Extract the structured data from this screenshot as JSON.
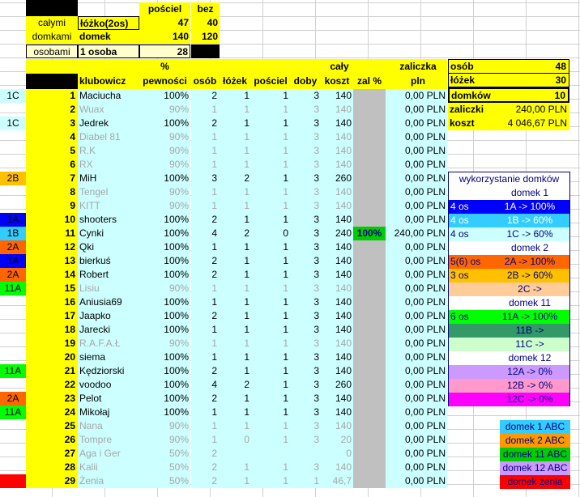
{
  "top_table": {
    "hdr_poscieli": "pościel",
    "hdr_bez": "bez",
    "row1_label": "całymi",
    "row1_name": "łóżko(2os)",
    "row1_v1": "47",
    "row1_v2": "40",
    "row2_label": "domkami",
    "row2_name": "domek",
    "row2_v1": "140",
    "row2_v2": "120",
    "row3_label": "osobami",
    "row3_name": "1 osoba",
    "row3_v1": "28"
  },
  "headers": {
    "pct_top": "%",
    "klubowicz": "klubowicz",
    "pewnosci": "pewności",
    "osob": "osób",
    "lozek": "łóżek",
    "posciel": "pościel",
    "doby": "doby",
    "caly": "cały",
    "koszt": "koszt",
    "zal": "zal %",
    "zaliczka": "zaliczka",
    "pln": "pln"
  },
  "rows": [
    {
      "code": "1C",
      "num": "1",
      "name": "Maciucha",
      "pct": "100%",
      "osob": "2",
      "lozek": "1",
      "posciel": "1",
      "doby": "3",
      "koszt": "140",
      "zal": "",
      "zaliczka": "0,00 PLN",
      "faint": false
    },
    {
      "code": "",
      "num": "2",
      "name": "Wuax",
      "pct": "90%",
      "osob": "1",
      "lozek": "1",
      "posciel": "1",
      "doby": "3",
      "koszt": "140",
      "zal": "",
      "zaliczka": "0,00 PLN",
      "faint": true
    },
    {
      "code": "1C",
      "num": "3",
      "name": "Jedrek",
      "pct": "100%",
      "osob": "2",
      "lozek": "1",
      "posciel": "1",
      "doby": "3",
      "koszt": "140",
      "zal": "",
      "zaliczka": "0,00 PLN",
      "faint": false
    },
    {
      "code": "",
      "num": "4",
      "name": "Diabel 81",
      "pct": "90%",
      "osob": "1",
      "lozek": "1",
      "posciel": "1",
      "doby": "3",
      "koszt": "140",
      "zal": "",
      "zaliczka": "0,00 PLN",
      "faint": true
    },
    {
      "code": "",
      "num": "5",
      "name": "R.K",
      "pct": "90%",
      "osob": "1",
      "lozek": "1",
      "posciel": "1",
      "doby": "3",
      "koszt": "140",
      "zal": "",
      "zaliczka": "0,00 PLN",
      "faint": true
    },
    {
      "code": "",
      "num": "6",
      "name": "RX",
      "pct": "90%",
      "osob": "1",
      "lozek": "1",
      "posciel": "1",
      "doby": "3",
      "koszt": "140",
      "zal": "",
      "zaliczka": "0,00 PLN",
      "faint": true
    },
    {
      "code": "2B",
      "num": "7",
      "name": "MiH",
      "pct": "100%",
      "osob": "3",
      "lozek": "2",
      "posciel": "1",
      "doby": "3",
      "koszt": "260",
      "zal": "",
      "zaliczka": "0,00 PLN",
      "faint": false
    },
    {
      "code": "",
      "num": "8",
      "name": "Tengel",
      "pct": "90%",
      "osob": "1",
      "lozek": "1",
      "posciel": "1",
      "doby": "3",
      "koszt": "140",
      "zal": "",
      "zaliczka": "0,00 PLN",
      "faint": true
    },
    {
      "code": "",
      "num": "9",
      "name": "KITT",
      "pct": "90%",
      "osob": "1",
      "lozek": "1",
      "posciel": "1",
      "doby": "3",
      "koszt": "140",
      "zal": "",
      "zaliczka": "0,00 PLN",
      "faint": true
    },
    {
      "code": "1A",
      "num": "10",
      "name": "shooters",
      "pct": "100%",
      "osob": "2",
      "lozek": "1",
      "posciel": "1",
      "doby": "3",
      "koszt": "140",
      "zal": "",
      "zaliczka": "0,00 PLN",
      "faint": false
    },
    {
      "code": "1B",
      "num": "11",
      "name": "Cynki",
      "pct": "100%",
      "osob": "4",
      "lozek": "2",
      "posciel": "0",
      "doby": "3",
      "koszt": "240",
      "zal": "100%",
      "zaliczka": "240,00 PLN",
      "faint": false
    },
    {
      "code": "2A",
      "num": "12",
      "name": "Qki",
      "pct": "100%",
      "osob": "1",
      "lozek": "1",
      "posciel": "1",
      "doby": "3",
      "koszt": "140",
      "zal": "",
      "zaliczka": "0,00 PLN",
      "faint": false
    },
    {
      "code": "1A",
      "num": "13",
      "name": "bierkuś",
      "pct": "100%",
      "osob": "2",
      "lozek": "1",
      "posciel": "1",
      "doby": "3",
      "koszt": "140",
      "zal": "",
      "zaliczka": "0,00 PLN",
      "faint": false
    },
    {
      "code": "2A",
      "num": "14",
      "name": "Robert",
      "pct": "100%",
      "osob": "2",
      "lozek": "1",
      "posciel": "1",
      "doby": "3",
      "koszt": "140",
      "zal": "",
      "zaliczka": "0,00 PLN",
      "faint": false
    },
    {
      "code": "11A",
      "num": "15",
      "name": "Lisiu",
      "pct": "90%",
      "osob": "1",
      "lozek": "1",
      "posciel": "1",
      "doby": "3",
      "koszt": "140",
      "zal": "",
      "zaliczka": "0,00 PLN",
      "faint": true
    },
    {
      "code": "",
      "num": "16",
      "name": "Aniusia69",
      "pct": "100%",
      "osob": "1",
      "lozek": "1",
      "posciel": "1",
      "doby": "3",
      "koszt": "140",
      "zal": "",
      "zaliczka": "0,00 PLN",
      "faint": false
    },
    {
      "code": "",
      "num": "17",
      "name": "Jaapko",
      "pct": "100%",
      "osob": "2",
      "lozek": "1",
      "posciel": "1",
      "doby": "3",
      "koszt": "140",
      "zal": "",
      "zaliczka": "0,00 PLN",
      "faint": false
    },
    {
      "code": "",
      "num": "18",
      "name": "Jarecki",
      "pct": "100%",
      "osob": "1",
      "lozek": "1",
      "posciel": "1",
      "doby": "3",
      "koszt": "140",
      "zal": "",
      "zaliczka": "0,00 PLN",
      "faint": false
    },
    {
      "code": "",
      "num": "19",
      "name": "R.A.F.A.Ł",
      "pct": "90%",
      "osob": "1",
      "lozek": "1",
      "posciel": "1",
      "doby": "3",
      "koszt": "140",
      "zal": "",
      "zaliczka": "0,00 PLN",
      "faint": true
    },
    {
      "code": "",
      "num": "20",
      "name": "siema",
      "pct": "100%",
      "osob": "1",
      "lozek": "1",
      "posciel": "1",
      "doby": "3",
      "koszt": "140",
      "zal": "",
      "zaliczka": "0,00 PLN",
      "faint": false
    },
    {
      "code": "11A",
      "num": "21",
      "name": "Kędziorski",
      "pct": "100%",
      "osob": "2",
      "lozek": "1",
      "posciel": "1",
      "doby": "3",
      "koszt": "140",
      "zal": "",
      "zaliczka": "0,00 PLN",
      "faint": false
    },
    {
      "code": "",
      "num": "22",
      "name": "voodoo",
      "pct": "100%",
      "osob": "4",
      "lozek": "2",
      "posciel": "1",
      "doby": "3",
      "koszt": "260",
      "zal": "",
      "zaliczka": "0,00 PLN",
      "faint": false
    },
    {
      "code": "2A",
      "num": "23",
      "name": "Pelot",
      "pct": "100%",
      "osob": "2",
      "lozek": "1",
      "posciel": "1",
      "doby": "3",
      "koszt": "140",
      "zal": "",
      "zaliczka": "0,00 PLN",
      "faint": false
    },
    {
      "code": "11A",
      "num": "24",
      "name": "Mikołaj",
      "pct": "100%",
      "osob": "1",
      "lozek": "1",
      "posciel": "1",
      "doby": "3",
      "koszt": "140",
      "zal": "",
      "zaliczka": "0,00 PLN",
      "faint": false
    },
    {
      "code": "",
      "num": "25",
      "name": "Nana",
      "pct": "90%",
      "osob": "1",
      "lozek": "1",
      "posciel": "1",
      "doby": "3",
      "koszt": "140",
      "zal": "",
      "zaliczka": "0,00 PLN",
      "faint": true
    },
    {
      "code": "",
      "num": "26",
      "name": "Tompre",
      "pct": "90%",
      "osob": "1",
      "lozek": "0",
      "posciel": "1",
      "doby": "3",
      "koszt": "20",
      "zal": "",
      "zaliczka": "0,00 PLN",
      "faint": true
    },
    {
      "code": "",
      "num": "27",
      "name": "Aga i Ger",
      "pct": "50%",
      "osob": "2",
      "lozek": "",
      "posciel": "",
      "doby": "",
      "koszt": "0",
      "zal": "",
      "zaliczka": "0,00 PLN",
      "faint": true
    },
    {
      "code": "",
      "num": "28",
      "name": "Kalii",
      "pct": "50%",
      "osob": "2",
      "lozek": "1",
      "posciel": "1",
      "doby": "3",
      "koszt": "140",
      "zal": "",
      "zaliczka": "0,00 PLN",
      "faint": true
    },
    {
      "code": "",
      "num": "29",
      "name": "Żenia",
      "pct": "50%",
      "osob": "2",
      "lozek": "1",
      "posciel": "1",
      "doby": "1",
      "koszt": "46,7",
      "zal": "",
      "zaliczka": "0,00 PLN",
      "faint": true
    }
  ],
  "row_code_colors": {
    "1C": "#ccffff",
    "2B": "#ffc000",
    "1A": "#0000ff",
    "1B": "#33ccff",
    "2A": "#ff6600",
    "11A": "#00ff00"
  },
  "summary": {
    "osob_label": "osób",
    "osob": "48",
    "lozek_label": "łóżek",
    "lozek": "30",
    "domkow_label": "domków",
    "domkow": "10",
    "zaliczki_label": "zaliczki",
    "zaliczki": "240,00 PLN",
    "koszt_label": "koszt",
    "koszt": "4 046,67 PLN"
  },
  "usage": {
    "title": "wykorzystanie domków",
    "rows": [
      {
        "left": "",
        "right": "domek 1",
        "bg": "#ffffff",
        "color": "#000080"
      },
      {
        "left": "4 os",
        "right": "1A -> 100%",
        "bg": "#0000ff",
        "color": "#ffffff"
      },
      {
        "left": "4 os",
        "right": "1B -> 60%",
        "bg": "#33ccff",
        "color": "#ffffff"
      },
      {
        "left": "4 os",
        "right": "1C -> 60%",
        "bg": "#ccffff",
        "color": "#000080"
      },
      {
        "left": "",
        "right": "domek 2",
        "bg": "#ffffff",
        "color": "#000080"
      },
      {
        "left": "5(6) os",
        "right": "2A -> 100%",
        "bg": "#ff6600",
        "color": "#000080"
      },
      {
        "left": "3 os",
        "right": "2B -> 60%",
        "bg": "#ffc000",
        "color": "#000080"
      },
      {
        "left": "",
        "right": "2C ->",
        "bg": "#ffcc99",
        "color": "#000080"
      },
      {
        "left": "",
        "right": "domek 11",
        "bg": "#ffffff",
        "color": "#000080"
      },
      {
        "left": "6 os",
        "right": "11A -> 100%",
        "bg": "#00ff00",
        "color": "#000080"
      },
      {
        "left": "",
        "right": "11B ->",
        "bg": "#339966",
        "color": "#000080"
      },
      {
        "left": "",
        "right": "11C ->",
        "bg": "#ccffcc",
        "color": "#000080"
      },
      {
        "left": "",
        "right": "domek 12",
        "bg": "#ffffff",
        "color": "#000080"
      },
      {
        "left": "",
        "right": "12A -> 0%",
        "bg": "#cc99ff",
        "color": "#000080"
      },
      {
        "left": "",
        "right": "12B -> 0%",
        "bg": "#ff99cc",
        "color": "#000080"
      },
      {
        "left": "",
        "right": "12C -> 0%",
        "bg": "#ff00ff",
        "color": "#000080"
      }
    ]
  },
  "legend": [
    {
      "label": "domek 1 ABC",
      "bg": "#33ccff"
    },
    {
      "label": "domek 2 ABC",
      "bg": "#ff9900"
    },
    {
      "label": "domek 11 ABC",
      "bg": "#00cc00"
    },
    {
      "label": "domek 12 ABC",
      "bg": "#cc99ff"
    },
    {
      "label": "domek żenia",
      "bg": "#ff0000"
    }
  ]
}
